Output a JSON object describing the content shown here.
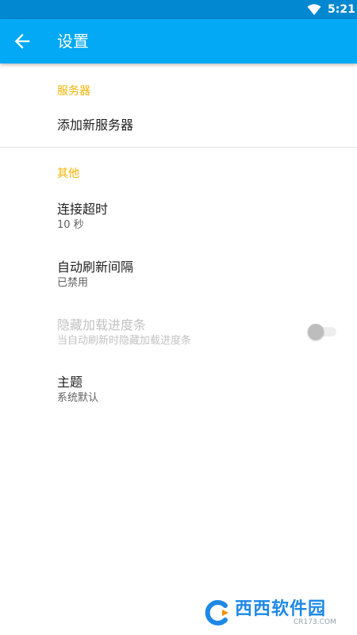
{
  "status_bar": {
    "time": "5:21",
    "wifi_icon": "wifi-icon"
  },
  "toolbar": {
    "back_icon": "arrow-back-icon",
    "title": "设置",
    "color": "#03a9f4",
    "status_color": "#0288d1"
  },
  "sections": {
    "servers": {
      "header": "服务器",
      "items": [
        {
          "title": "添加新服务器"
        }
      ]
    },
    "other": {
      "header": "其他",
      "items": [
        {
          "title": "连接超时",
          "summary": "10 秒"
        },
        {
          "title": "自动刷新间隔",
          "summary": "已禁用"
        },
        {
          "title": "隐藏加载进度条",
          "summary": "当自动刷新时隐藏加载进度条",
          "enabled": false,
          "switch_on": false
        },
        {
          "title": "主题",
          "summary": "系统默认"
        }
      ]
    }
  },
  "accent_color": "#f4b400",
  "watermark": {
    "text": "西西软件园",
    "url": "CR173.COM"
  }
}
